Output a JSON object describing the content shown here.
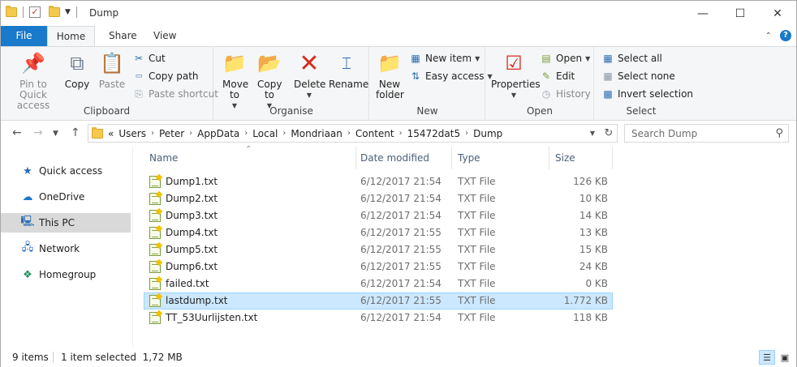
{
  "window": {
    "title": "Dump"
  },
  "tabs": {
    "file": "File",
    "home": "Home",
    "share": "Share",
    "view": "View"
  },
  "ribbon": {
    "clipboard": {
      "label": "Clipboard",
      "pin": "Pin to Quick access",
      "copy": "Copy",
      "paste": "Paste",
      "cut": "Cut",
      "copy_path": "Copy path",
      "paste_shortcut": "Paste shortcut"
    },
    "organise": {
      "label": "Organise",
      "move_to": "Move to",
      "copy_to": "Copy to",
      "delete": "Delete",
      "rename": "Rename"
    },
    "new": {
      "label": "New",
      "new_folder": "New folder",
      "new_item": "New item",
      "easy_access": "Easy access"
    },
    "open": {
      "label": "Open",
      "properties": "Properties",
      "open": "Open",
      "edit": "Edit",
      "history": "History"
    },
    "select": {
      "label": "Select",
      "select_all": "Select all",
      "select_none": "Select none",
      "invert_selection": "Invert selection"
    }
  },
  "address": {
    "overflow": "«",
    "crumbs": [
      "Users",
      "Peter",
      "AppData",
      "Local",
      "Mondriaan",
      "Content",
      "15472dat5",
      "Dump"
    ],
    "search_placeholder": "Search Dump"
  },
  "nav": {
    "items": [
      "Quick access",
      "OneDrive",
      "This PC",
      "Network",
      "Homegroup"
    ]
  },
  "columns": {
    "name": "Name",
    "date": "Date modified",
    "type": "Type",
    "size": "Size"
  },
  "files": [
    {
      "name": "Dump1.txt",
      "date": "6/12/2017 21:54",
      "type": "TXT File",
      "size": "126 KB"
    },
    {
      "name": "Dump2.txt",
      "date": "6/12/2017 21:54",
      "type": "TXT File",
      "size": "10 KB"
    },
    {
      "name": "Dump3.txt",
      "date": "6/12/2017 21:54",
      "type": "TXT File",
      "size": "14 KB"
    },
    {
      "name": "Dump4.txt",
      "date": "6/12/2017 21:55",
      "type": "TXT File",
      "size": "13 KB"
    },
    {
      "name": "Dump5.txt",
      "date": "6/12/2017 21:55",
      "type": "TXT File",
      "size": "15 KB"
    },
    {
      "name": "Dump6.txt",
      "date": "6/12/2017 21:55",
      "type": "TXT File",
      "size": "24 KB"
    },
    {
      "name": "failed.txt",
      "date": "6/12/2017 21:54",
      "type": "TXT File",
      "size": "0 KB"
    },
    {
      "name": "lastdump.txt",
      "date": "6/12/2017 21:55",
      "type": "TXT File",
      "size": "1.772 KB"
    },
    {
      "name": "TT_53Uurlijsten.txt",
      "date": "6/12/2017 21:54",
      "type": "TXT File",
      "size": "118 KB"
    }
  ],
  "status": {
    "count": "9 items",
    "selected": "1 item selected  1,72 MB"
  },
  "colors": {
    "accent": "#1979ca",
    "selection": "#cce8ff",
    "selection_border": "#99d1ff"
  }
}
